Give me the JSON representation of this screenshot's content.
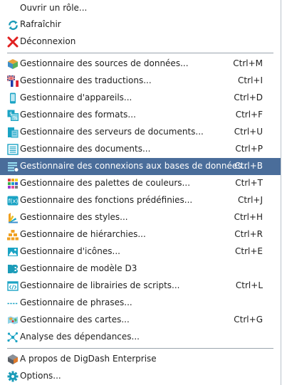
{
  "menu": {
    "items": [
      {
        "label": "Ouvrir un rôle...",
        "shortcut": "",
        "icon": "none"
      },
      {
        "label": "Rafraîchir",
        "shortcut": "",
        "icon": "refresh-icon"
      },
      {
        "label": "Déconnexion",
        "shortcut": "",
        "icon": "disconnect-icon"
      },
      {
        "label": "Gestionnaire des sources de données...",
        "shortcut": "Ctrl+M",
        "icon": "data-source-cube-icon"
      },
      {
        "label": "Gestionnaire des traductions...",
        "shortcut": "Ctrl+I",
        "icon": "translation-flags-icon"
      },
      {
        "label": "Gestionnaire d'appareils...",
        "shortcut": "Ctrl+D",
        "icon": "device-icon"
      },
      {
        "label": "Gestionnaire des formats...",
        "shortcut": "Ctrl+F",
        "icon": "format-icon"
      },
      {
        "label": "Gestionnaire des serveurs de documents...",
        "shortcut": "Ctrl+U",
        "icon": "document-server-icon"
      },
      {
        "label": "Gestionnaire des documents...",
        "shortcut": "Ctrl+P",
        "icon": "documents-icon"
      },
      {
        "label": "Gestionnaire des connexions aux bases de données...",
        "shortcut": "Ctrl+B",
        "icon": "database-connection-icon"
      },
      {
        "label": "Gestionnaire des palettes de couleurs...",
        "shortcut": "Ctrl+T",
        "icon": "color-palette-icon"
      },
      {
        "label": "Gestionnaire des fonctions prédéfinies...",
        "shortcut": "Ctrl+J",
        "icon": "function-icon"
      },
      {
        "label": "Gestionnaire des styles...",
        "shortcut": "Ctrl+H",
        "icon": "styles-icon"
      },
      {
        "label": "Gestionnaire de hiérarchies...",
        "shortcut": "Ctrl+R",
        "icon": "hierarchy-icon"
      },
      {
        "label": "Gestionnaire d'icônes...",
        "shortcut": "Ctrl+E",
        "icon": "image-icon"
      },
      {
        "label": "Gestionnaire de modèle D3",
        "shortcut": "",
        "icon": "d3-icon"
      },
      {
        "label": "Gestionnaire de librairies de scripts...",
        "shortcut": "Ctrl+L",
        "icon": "script-library-icon"
      },
      {
        "label": "Gestionnaire de phrases...",
        "shortcut": "",
        "icon": "phrases-icon"
      },
      {
        "label": "Gestionnaire des cartes...",
        "shortcut": "Ctrl+G",
        "icon": "map-icon"
      },
      {
        "label": "Analyse des dépendances...",
        "shortcut": "",
        "icon": "dependency-icon"
      },
      {
        "label": "A propos de DigDash Enterprise",
        "shortcut": "",
        "icon": "about-icon"
      },
      {
        "label": "Options...",
        "shortcut": "",
        "icon": "options-gear-icon"
      }
    ],
    "highlighted_index": 9,
    "colors": {
      "highlight": "#4a6d9a",
      "separator": "#9aa4ad"
    }
  }
}
